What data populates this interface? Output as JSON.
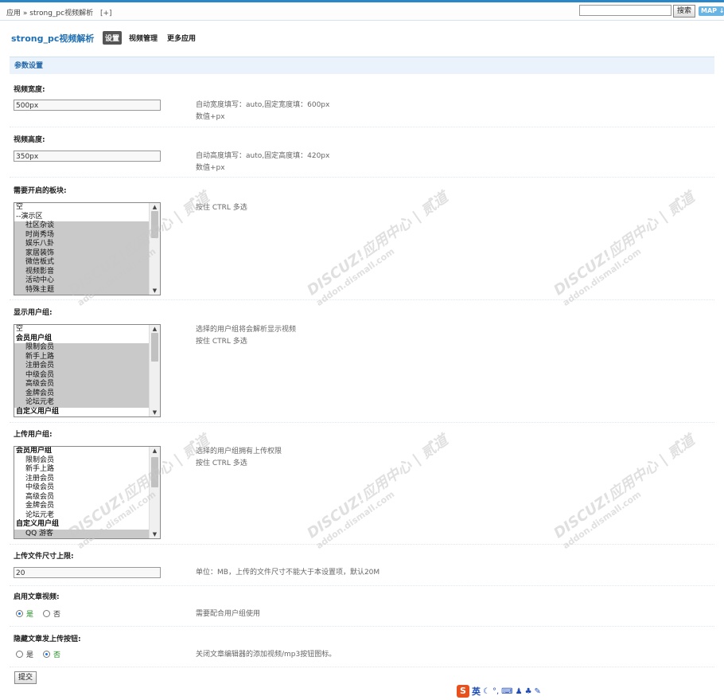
{
  "breadcrumb": {
    "app": "应用",
    "sep": "»",
    "plugin": "strong_pc视频解析",
    "add": "[+]"
  },
  "search": {
    "button": "搜索",
    "map": "MAP ↓"
  },
  "plugin_title": "strong_pc视频解析",
  "tabs": [
    "设置",
    "视频管理",
    "更多应用"
  ],
  "section_title": "参数设置",
  "fields": {
    "width": {
      "label": "视频宽度:",
      "value": "500px",
      "hint1": "自动宽度填写：auto,固定宽度填：600px",
      "hint2": "数值+px"
    },
    "height": {
      "label": "视频高度:",
      "value": "350px",
      "hint1": "自动高度填写：auto,固定高度填：420px",
      "hint2": "数值+px"
    },
    "forums": {
      "label": "需要开启的板块:",
      "hint1": "按住 CTRL 多选",
      "options": [
        {
          "text": "空",
          "type": "plain",
          "sel": false
        },
        {
          "text": "--演示区",
          "type": "plain",
          "sel": false
        },
        {
          "text": "社区杂谈",
          "type": "child",
          "sel": true
        },
        {
          "text": "时尚秀场",
          "type": "child",
          "sel": true
        },
        {
          "text": "娱乐八卦",
          "type": "child",
          "sel": true
        },
        {
          "text": "家居装饰",
          "type": "child",
          "sel": true
        },
        {
          "text": "微信板式",
          "type": "child",
          "sel": true
        },
        {
          "text": "视频影音",
          "type": "child",
          "sel": true
        },
        {
          "text": "活动中心",
          "type": "child",
          "sel": true
        },
        {
          "text": "特殊主题",
          "type": "child",
          "sel": true
        }
      ]
    },
    "show_groups": {
      "label": "显示用户组:",
      "hint1": "选择的用户组将会解析显示视频",
      "hint2": "按住 CTRL 多选",
      "options": [
        {
          "text": "空",
          "type": "plain",
          "sel": false
        },
        {
          "text": "会员用户组",
          "type": "group",
          "sel": false
        },
        {
          "text": "限制会员",
          "type": "child",
          "sel": true
        },
        {
          "text": "新手上路",
          "type": "child",
          "sel": true
        },
        {
          "text": "注册会员",
          "type": "child",
          "sel": true
        },
        {
          "text": "中级会员",
          "type": "child",
          "sel": true
        },
        {
          "text": "高级会员",
          "type": "child",
          "sel": true
        },
        {
          "text": "金牌会员",
          "type": "child",
          "sel": true
        },
        {
          "text": "论坛元老",
          "type": "child",
          "sel": true
        },
        {
          "text": "自定义用户组",
          "type": "group",
          "sel": false
        }
      ]
    },
    "upload_groups": {
      "label": "上传用户组:",
      "hint1": "选择的用户组拥有上传权限",
      "hint2": "按住 CTRL 多选",
      "options": [
        {
          "text": "会员用户组",
          "type": "group",
          "sel": false
        },
        {
          "text": "限制会员",
          "type": "child",
          "sel": false
        },
        {
          "text": "新手上路",
          "type": "child",
          "sel": false
        },
        {
          "text": "注册会员",
          "type": "child",
          "sel": false
        },
        {
          "text": "中级会员",
          "type": "child",
          "sel": false
        },
        {
          "text": "高级会员",
          "type": "child",
          "sel": false
        },
        {
          "text": "金牌会员",
          "type": "child",
          "sel": false
        },
        {
          "text": "论坛元老",
          "type": "child",
          "sel": false
        },
        {
          "text": "自定义用户组",
          "type": "group",
          "sel": false
        },
        {
          "text": "QQ 游客",
          "type": "child",
          "sel": true
        }
      ]
    },
    "max_size": {
      "label": "上传文件尺寸上限:",
      "value": "20",
      "hint1": "单位：MB，上传的文件尺寸不能大于本设置项，默认20M"
    },
    "article_video": {
      "label": "启用文章视频:",
      "yes": "是",
      "no": "否",
      "selected": "yes",
      "hint1": "需要配合用户组使用"
    },
    "hide_upload": {
      "label": "隐藏文章发上传按钮:",
      "yes": "是",
      "no": "否",
      "selected": "no",
      "hint1": "关闭文章编辑器的添加视频/mp3按钮图标。"
    }
  },
  "submit": "提交",
  "ime": {
    "logo": "S",
    "lang": "英"
  },
  "watermark": {
    "main": "DISCUZ!应用中心 | 贰道",
    "sub": "addon.dismall.com"
  }
}
